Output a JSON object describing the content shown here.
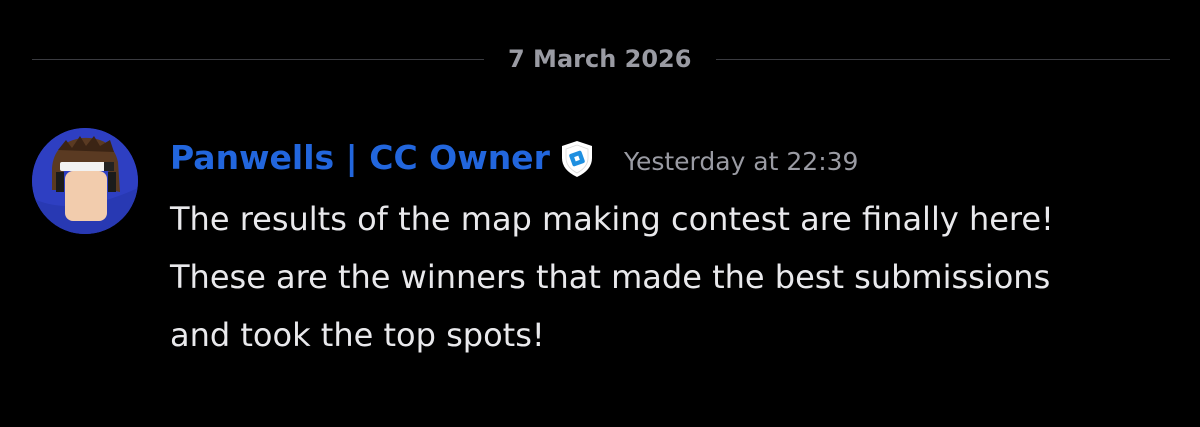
{
  "divider": {
    "date": "7 March 2026"
  },
  "message": {
    "author": {
      "name": "Panwells | CC Owner",
      "color": "#2266dd",
      "avatar_bg": "#2e3fc2"
    },
    "badge_icon": "shield-badge-icon",
    "timestamp": "Yesterday at 22:39",
    "content_lines": [
      "The results of the map making contest are finally here!",
      "These are the winners that made the best submissions",
      "and took the top spots!"
    ]
  }
}
